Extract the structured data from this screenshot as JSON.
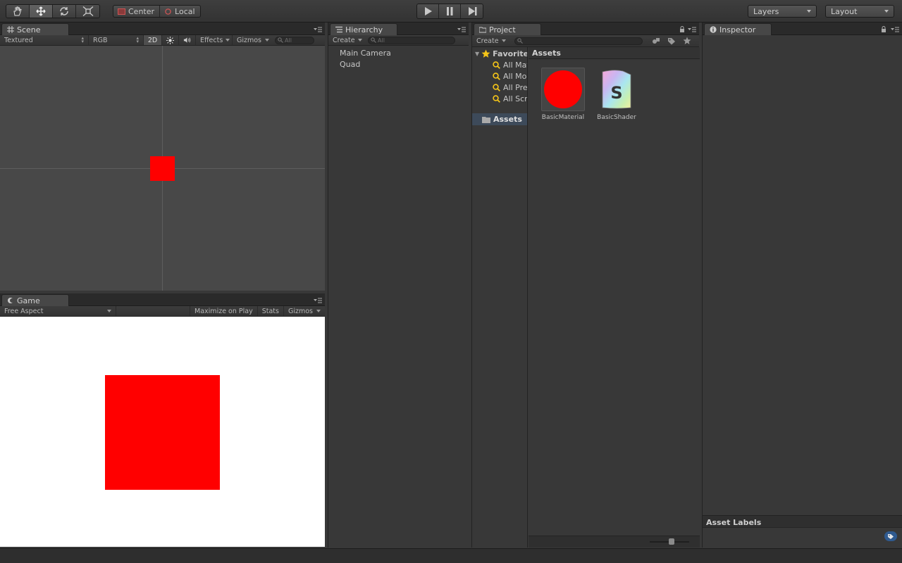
{
  "toolbar": {
    "transform_tools": [
      "hand-icon",
      "move-icon",
      "rotate-icon",
      "scale-icon"
    ],
    "active_tool": "move-icon",
    "pivot_center_label": "Center",
    "pivot_local_label": "Local",
    "playback": [
      "play-icon",
      "pause-icon",
      "step-icon"
    ],
    "layers_label": "Layers",
    "layout_label": "Layout"
  },
  "scene": {
    "tab_label": "Scene",
    "draw_mode": "Textured",
    "render_mode": "RGB",
    "toggle_2d": "2D",
    "effects_label": "Effects",
    "gizmos_label": "Gizmos",
    "search_placeholder": "All"
  },
  "game": {
    "tab_label": "Game",
    "aspect": "Free Aspect",
    "maximize_label": "Maximize on Play",
    "stats_label": "Stats",
    "gizmos_label": "Gizmos"
  },
  "hierarchy": {
    "tab_label": "Hierarchy",
    "create_label": "Create",
    "search_placeholder": "All",
    "items": [
      "Main Camera",
      "Quad"
    ]
  },
  "project": {
    "tab_label": "Project",
    "create_label": "Create",
    "favorites_label": "Favorites",
    "favorites": [
      "All Materials",
      "All Models",
      "All Prefabs",
      "All Scripts"
    ],
    "assets_folder_label": "Assets",
    "breadcrumb": "Assets",
    "assets": [
      {
        "name": "BasicMaterial",
        "icon": "material-sphere-icon",
        "color": "#ff0000"
      },
      {
        "name": "BasicShader",
        "icon": "shader-icon",
        "glyph": "S"
      }
    ]
  },
  "inspector": {
    "tab_label": "Inspector",
    "asset_labels_title": "Asset Labels"
  },
  "colors": {
    "red": "#ff0000",
    "scene_bg": "#484848",
    "game_bg": "#ffffff",
    "panel_bg": "#383838"
  }
}
